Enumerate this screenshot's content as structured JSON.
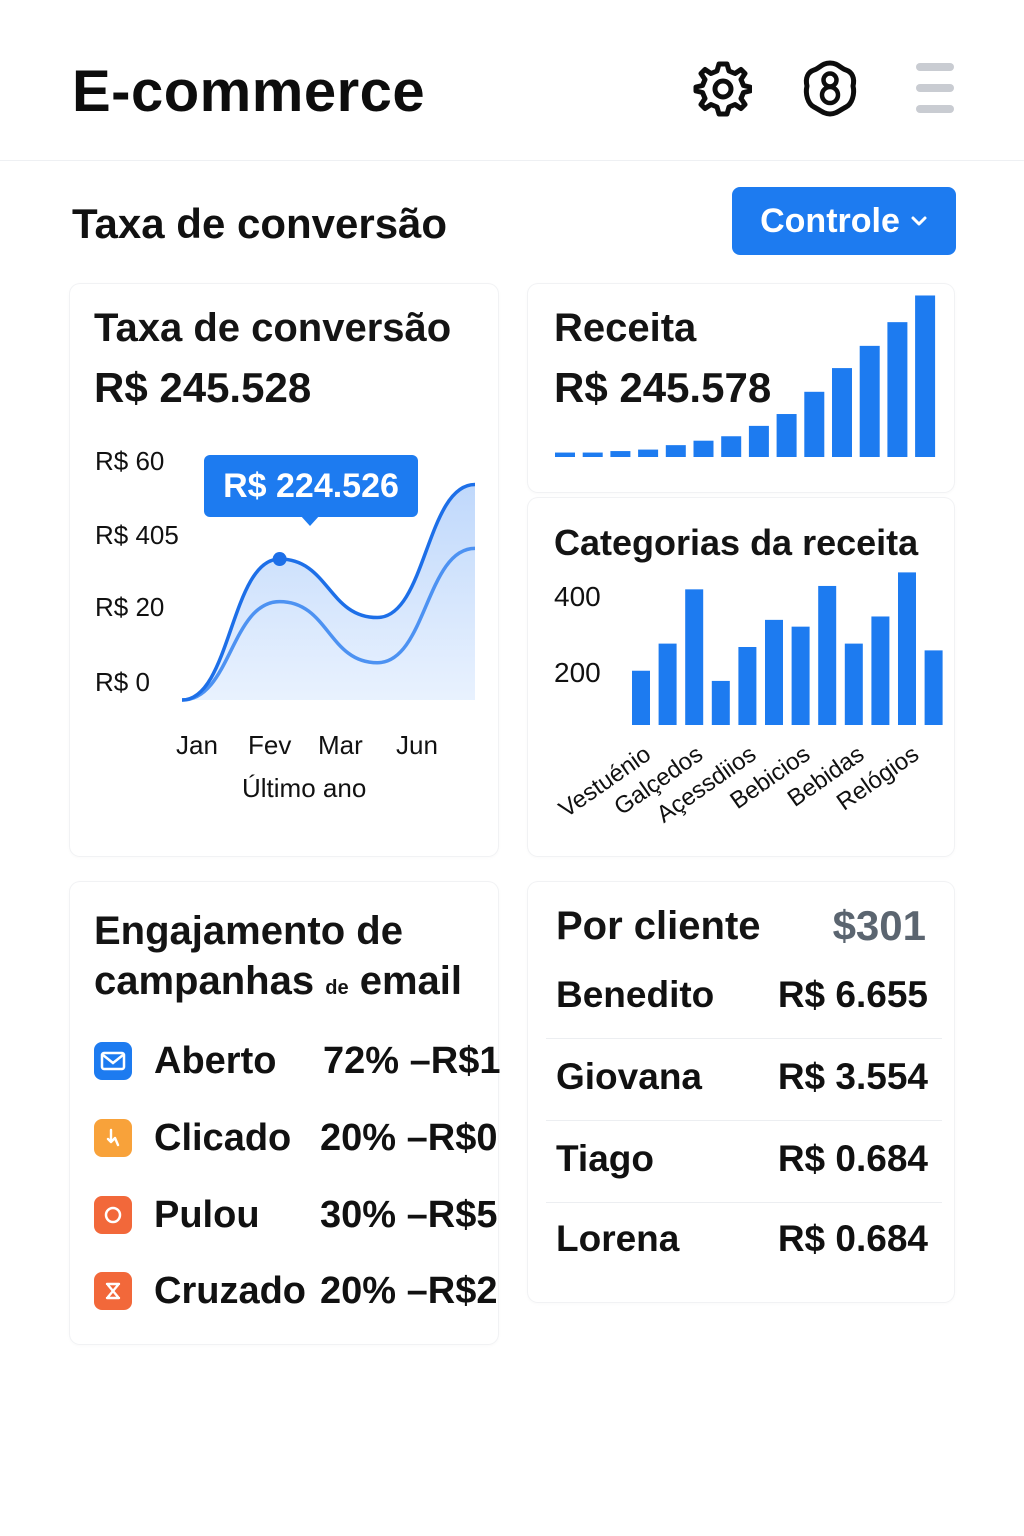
{
  "header": {
    "title": "E-commerce",
    "icons": [
      "gear-icon",
      "badge-icon",
      "menu-icon"
    ]
  },
  "toolbar": {
    "section_title": "Taxa de conversão",
    "controle_label": "Controle"
  },
  "colors": {
    "accent": "#1d7bf0",
    "orange": "#f8a23a",
    "red_orange": "#f2683a",
    "muted": "#5b6570"
  },
  "conversion_card": {
    "title": "Taxa de conversão",
    "value": "R$ 245.528",
    "tooltip": "R$ 224.526",
    "xlabel": "Último ano",
    "chart_data": {
      "type": "area",
      "title": "Taxa de conversão",
      "xlabel": "Último ano",
      "ylabel": "",
      "y_tick_labels": [
        "R$ 60",
        "R$ 405",
        "R$ 20",
        "R$ 0"
      ],
      "x_tick_labels": [
        "Jan",
        "Fev",
        "Mar",
        "Jun"
      ],
      "categories": [
        "Jan",
        "Fev",
        "Mar",
        "Jun"
      ],
      "series": [
        {
          "values": [
            0,
            0.53,
            0.31,
            0.81
          ]
        },
        {
          "values": [
            0,
            0.37,
            0.14,
            0.57
          ]
        }
      ],
      "highlight": {
        "category": "Fev",
        "series_index": 0,
        "label": "R$ 224.526"
      },
      "ylim": [
        0,
        1
      ],
      "grid": false
    }
  },
  "revenue_card": {
    "title": "Receita",
    "value": "R$ 245.578",
    "chart_data": {
      "type": "bar",
      "title": "Receita",
      "categories": [],
      "values": [
        3,
        3,
        4,
        5,
        8,
        11,
        14,
        21,
        29,
        44,
        60,
        75,
        91,
        109
      ],
      "ylim": [
        0,
        110
      ],
      "grid": false
    }
  },
  "categories_card": {
    "title": "Categorias da receita",
    "chart_data": {
      "type": "bar",
      "title": "Categorias da receita",
      "y_tick_labels": [
        "400",
        "200"
      ],
      "categories": [
        "Vestuénio",
        "Galçedos",
        "Açessdiios",
        "Bebicios",
        "Bebidas",
        "Relógios"
      ],
      "values": [
        160,
        240,
        400,
        130,
        230,
        310,
        290,
        410,
        240,
        320,
        450,
        220
      ],
      "ylim": [
        0,
        460
      ],
      "grid": false
    }
  },
  "email_card": {
    "title_line1": "Engajamento de",
    "title_line2_a": "campanhas",
    "title_line2_small": "de",
    "title_line2_b": "email",
    "items": [
      {
        "label": "Aberto",
        "value": "72% –R$1",
        "icon": "envelope-icon",
        "color": "#1d7bf0"
      },
      {
        "label": "Clicado",
        "value": "20% –R$0",
        "icon": "click-icon",
        "color": "#f8a23a"
      },
      {
        "label": "Pulou",
        "value": "30% –R$5",
        "icon": "bounce-icon",
        "color": "#f2683a"
      },
      {
        "label": "Cruzado",
        "value": "20% –R$2",
        "icon": "cross-icon",
        "color": "#f2683a"
      }
    ]
  },
  "customer_card": {
    "title": "Por cliente",
    "total": "$301",
    "rows": [
      {
        "name": "Benedito",
        "amount": "R$ 6.655"
      },
      {
        "name": "Giovana",
        "amount": "R$ 3.554"
      },
      {
        "name": "Tiago",
        "amount": "R$ 0.684"
      },
      {
        "name": "Lorena",
        "amount": "R$ 0.684"
      }
    ]
  }
}
